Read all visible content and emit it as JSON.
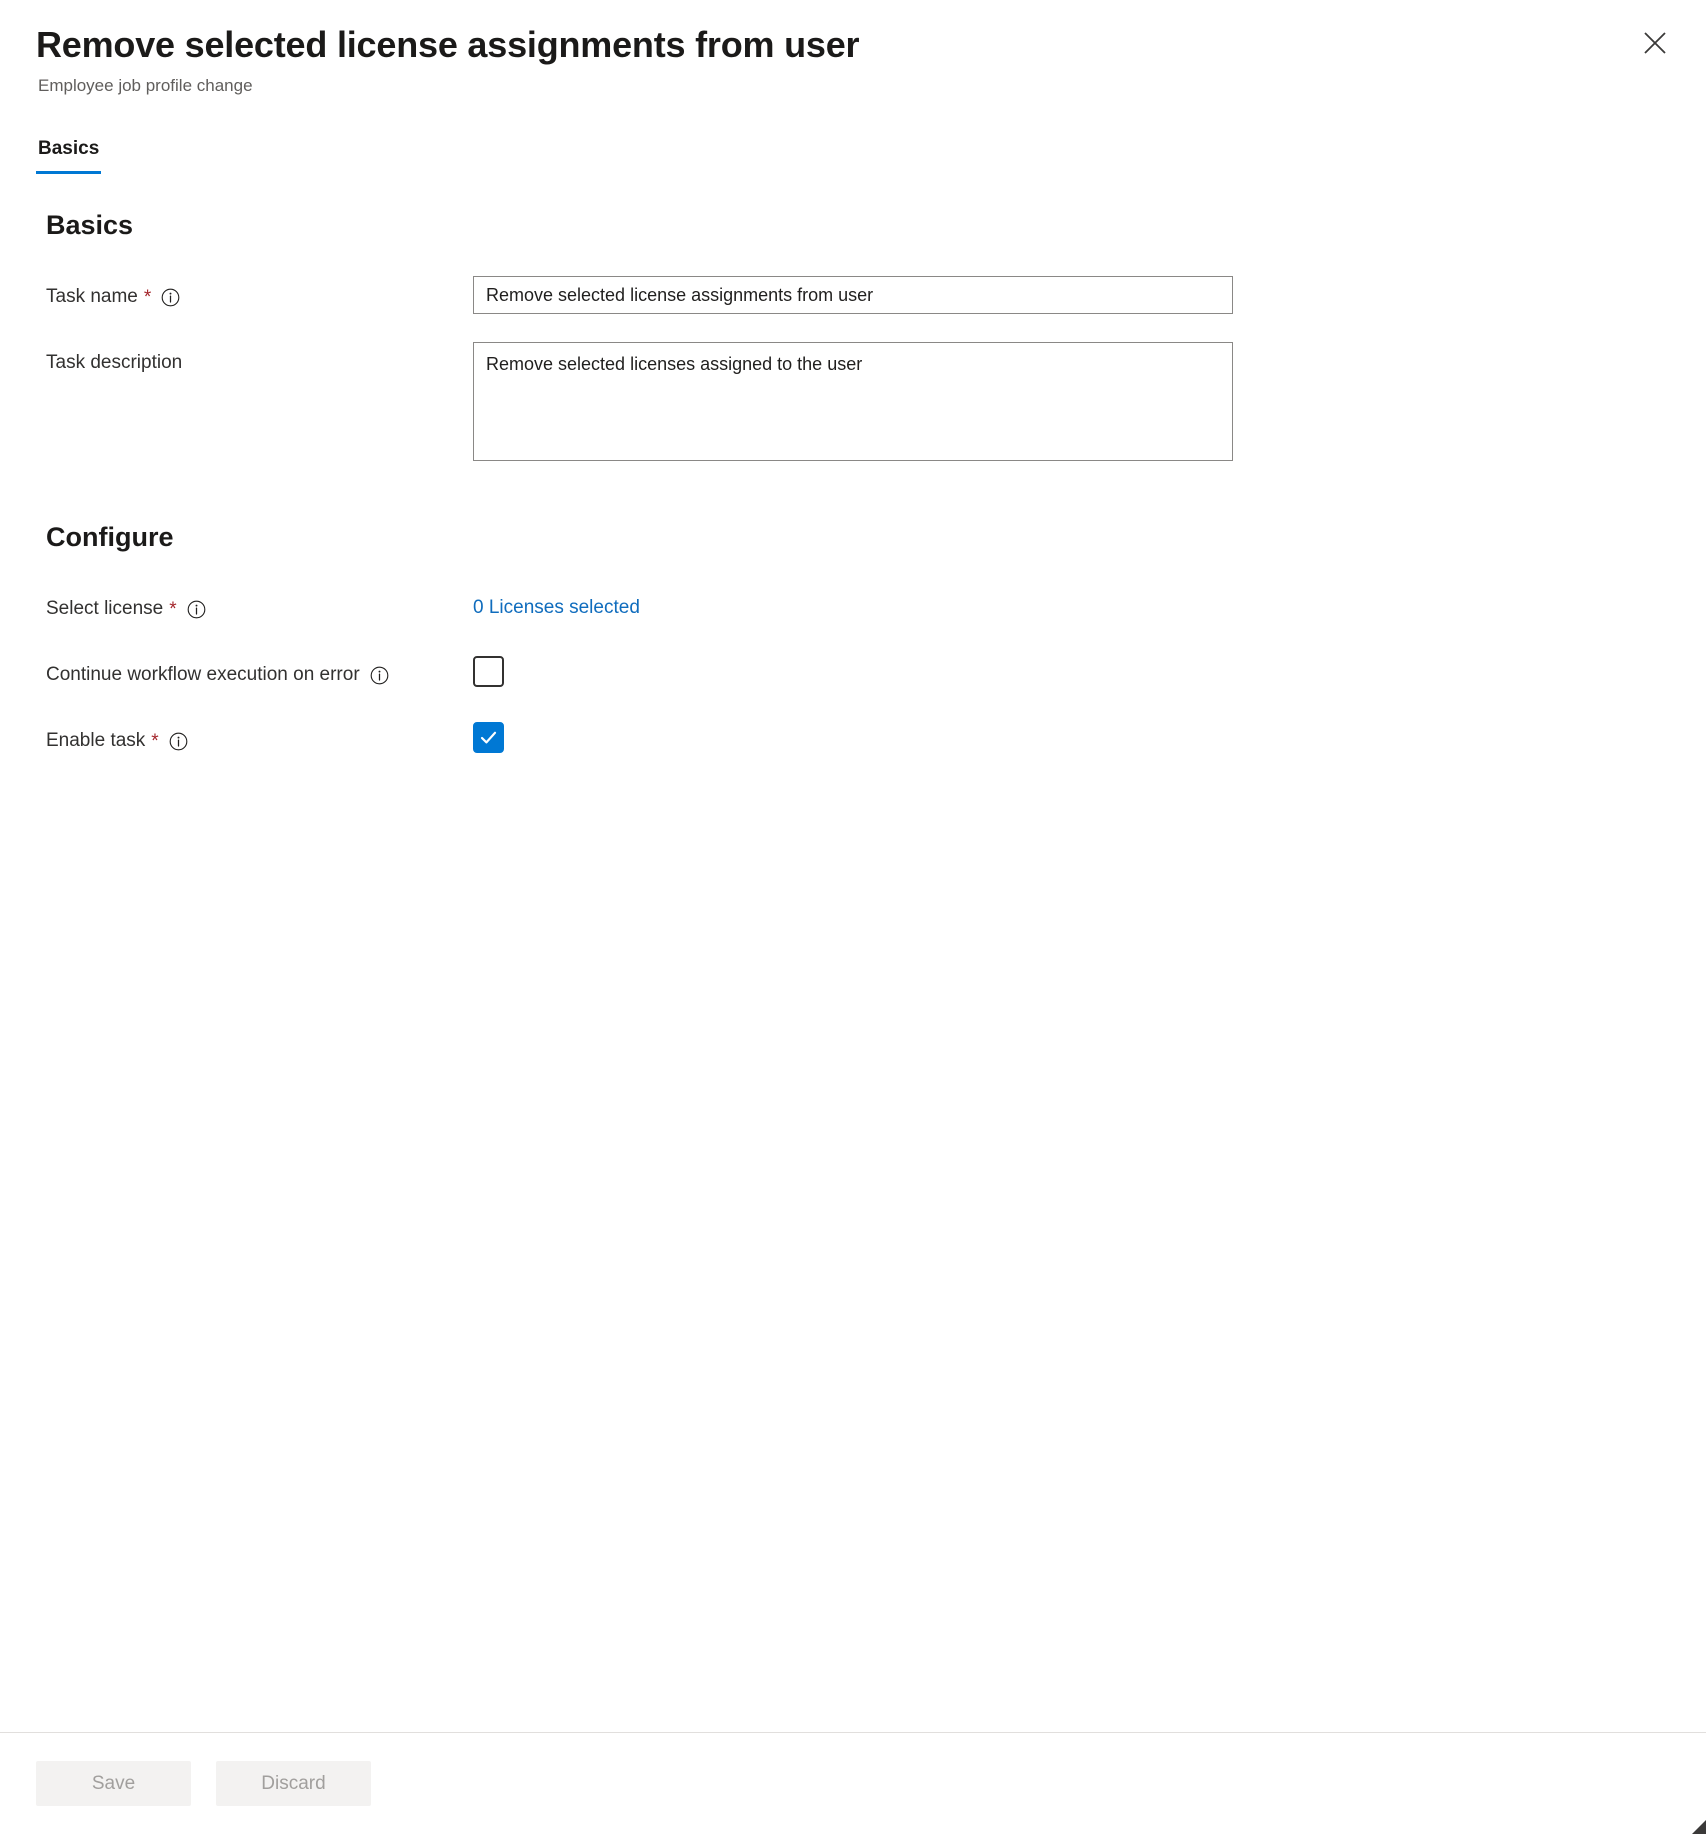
{
  "header": {
    "title": "Remove selected license assignments from user",
    "subtitle": "Employee job profile change",
    "close_label": "Close",
    "close_icon": "close-icon"
  },
  "tabs": [
    {
      "label": "Basics",
      "selected": true
    }
  ],
  "sections": {
    "basics": {
      "heading": "Basics",
      "fields": [
        {
          "label": "Task name",
          "required": true,
          "required_marker": "*",
          "info_icon": "info-icon",
          "type": "text",
          "value": "Remove selected license assignments from user",
          "placeholder": ""
        },
        {
          "label": "Task description",
          "required": false,
          "required_marker": "",
          "info_icon": "",
          "type": "textarea",
          "value": "Remove selected licenses assigned to the user",
          "placeholder": ""
        }
      ]
    },
    "configure": {
      "heading": "Configure",
      "fields": [
        {
          "label": "Select license",
          "required": true,
          "required_marker": "*",
          "info_icon": "info-icon",
          "type": "link",
          "value": "0 Licenses selected"
        },
        {
          "label": "Continue workflow execution on error",
          "required": false,
          "required_marker": "",
          "info_icon": "info-icon",
          "type": "checkbox",
          "checked": false
        },
        {
          "label": "Enable task",
          "required": true,
          "required_marker": "*",
          "info_icon": "info-icon",
          "type": "checkbox",
          "checked": true
        }
      ]
    }
  },
  "footer": {
    "save_label": "Save",
    "discard_label": "Discard"
  },
  "colors": {
    "accent": "#0078d4",
    "link": "#0f6cbd",
    "required": "#a4262c",
    "text": "#323130",
    "subtle_text": "#605e5c",
    "disabled_button_bg": "#f3f2f1",
    "disabled_button_text": "#a19f9d",
    "border": "#8a8886",
    "divider": "#e1dfdd"
  }
}
